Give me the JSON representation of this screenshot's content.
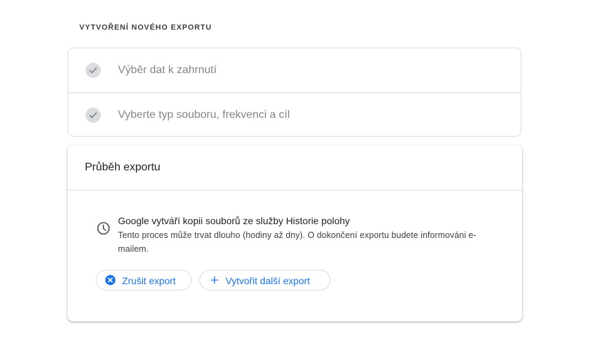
{
  "section_title": "VYTVOŘENÍ NOVÉHO EXPORTU",
  "steps": [
    {
      "label": "Výběr dat k zahrnutí",
      "icon": "check-icon",
      "status": "completed"
    },
    {
      "label": "Vyberte typ souboru, frekvenci a cíl",
      "icon": "check-icon",
      "status": "completed"
    }
  ],
  "progress": {
    "title": "Průběh exportu",
    "icon": "clock-icon",
    "message_title": "Google vytváří kopii souborů ze služby Historie polohy",
    "message_detail": "Tento proces může trvat dlouho (hodiny až dny). O dokončení exportu budete informováni e-mailem."
  },
  "buttons": {
    "cancel_label": "Zrušit export",
    "cancel_icon": "cancel-circle-icon",
    "new_label": "Vytvořit další export",
    "new_icon": "plus-icon"
  },
  "colors": {
    "accent": "#1a73e8",
    "check_bg": "#dadce0",
    "muted_text": "#80868b"
  }
}
